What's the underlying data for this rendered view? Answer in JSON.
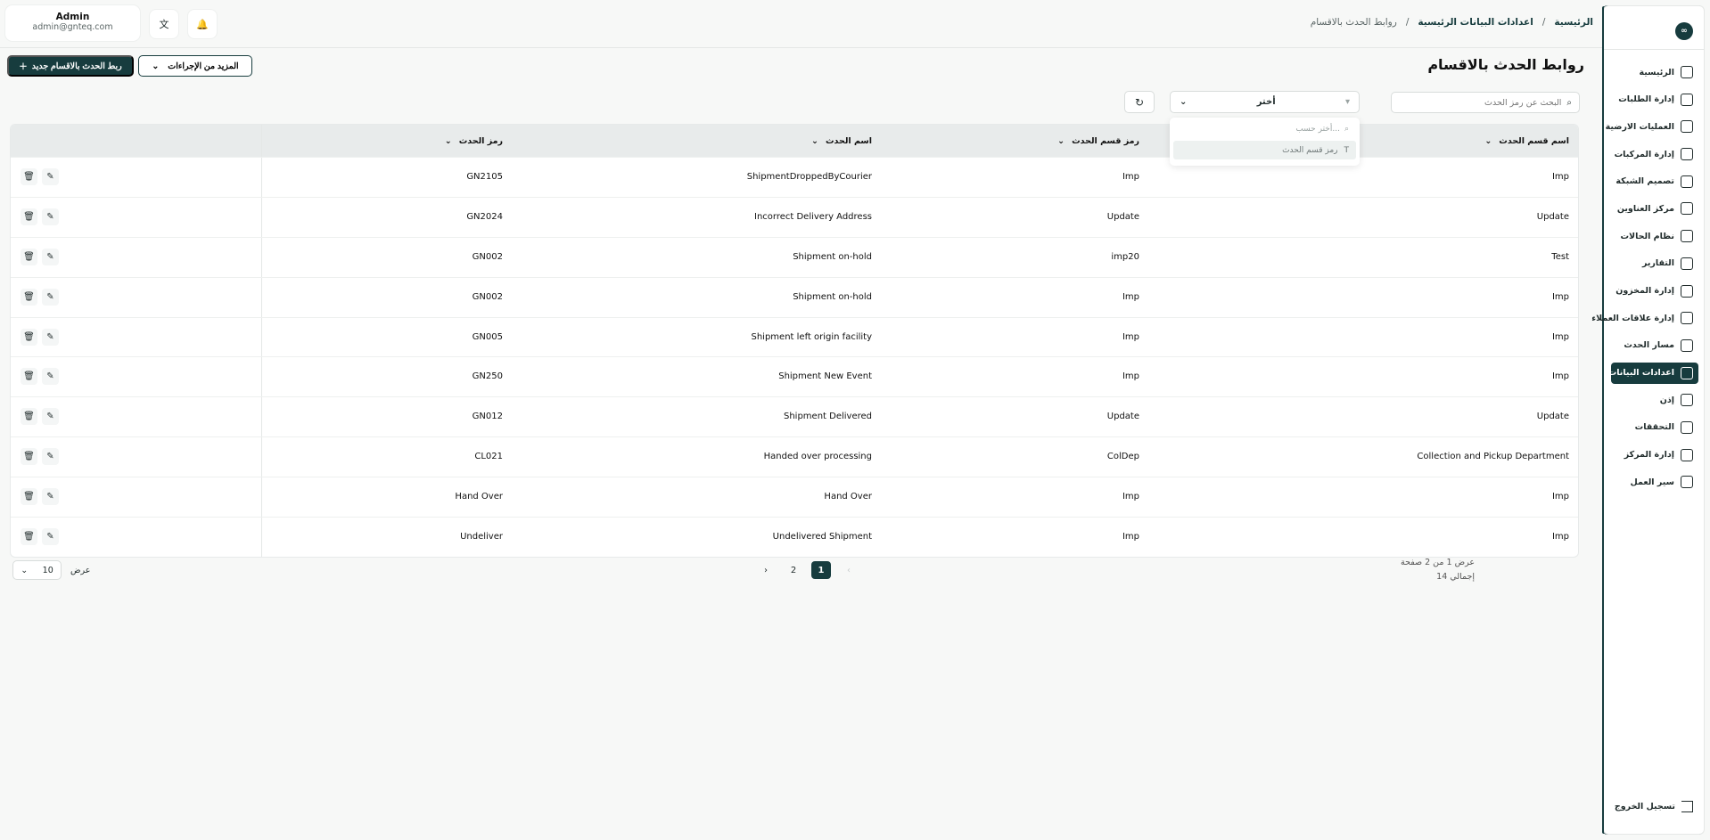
{
  "sidebar": {
    "logo": "∞",
    "items": [
      {
        "label": "الرئيسية",
        "icon": "dashboard-icon",
        "active": false
      },
      {
        "label": "إدارة الطلبات",
        "icon": "orders-icon",
        "active": false
      },
      {
        "label": "العمليات الارضية",
        "icon": "ground-ops-icon",
        "active": false
      },
      {
        "label": "إدارة المركبات",
        "icon": "truck-icon",
        "active": false
      },
      {
        "label": "تصميم الشبكة",
        "icon": "network-icon",
        "active": false
      },
      {
        "label": "مركز العناوين",
        "icon": "address-icon",
        "active": false
      },
      {
        "label": "نظام الحالات",
        "icon": "status-icon",
        "active": false
      },
      {
        "label": "التقارير",
        "icon": "reports-icon",
        "active": false
      },
      {
        "label": "إدارة المخزون",
        "icon": "inventory-icon",
        "active": false
      },
      {
        "label": "إدارة علاقات العملاء",
        "icon": "crm-icon",
        "active": false
      },
      {
        "label": "مسار الحدث",
        "icon": "route-icon",
        "active": false
      },
      {
        "label": "اعدادات البيانات",
        "icon": "database-icon",
        "active": true
      },
      {
        "label": "إذن",
        "icon": "permission-icon",
        "active": false
      },
      {
        "label": "التحققات",
        "icon": "validation-icon",
        "active": false
      },
      {
        "label": "إدارة المركز",
        "icon": "center-icon",
        "active": false
      },
      {
        "label": "سير العمل",
        "icon": "workflow-icon",
        "active": false
      }
    ],
    "logout": "تسجيل الخروج"
  },
  "header": {
    "breadcrumb": [
      "الرئيسية",
      "اعدادات البيانات الرئيسية",
      "روابط الحدث بالاقسام"
    ],
    "user": {
      "name": "Admin",
      "email": "admin@gnteq.com"
    },
    "translate_icon": "translate-icon",
    "bell_icon": "bell-icon"
  },
  "page": {
    "title": "روابط الحدث بالاقسام",
    "primary_button": "ربط الحدث بالاقسام جديد",
    "more_button": "المزيد من الإجراءات",
    "search_placeholder": "البحث عن رمز الحدث",
    "filter_label": "أختر",
    "dropdown_search_placeholder": "أختر حسب...",
    "dropdown_option": "رمز قسم الحدث"
  },
  "table": {
    "headers": {
      "department_name": "اسم قسم الحدث",
      "department_code": "رمز قسم الحدث",
      "event_name": "اسم الحدث",
      "event_code": "رمز الحدث"
    },
    "rows": [
      {
        "department_name": "Imp",
        "department_code": "Imp",
        "event_name": "ShipmentDroppedByCourier",
        "event_code": "GN2105"
      },
      {
        "department_name": "Update",
        "department_code": "Update",
        "event_name": "Incorrect Delivery Address",
        "event_code": "GN2024"
      },
      {
        "department_name": "Test",
        "department_code": "imp20",
        "event_name": "Shipment on-hold",
        "event_code": "GN002"
      },
      {
        "department_name": "Imp",
        "department_code": "Imp",
        "event_name": "Shipment on-hold",
        "event_code": "GN002"
      },
      {
        "department_name": "Imp",
        "department_code": "Imp",
        "event_name": "Shipment left origin facility",
        "event_code": "GN005"
      },
      {
        "department_name": "Imp",
        "department_code": "Imp",
        "event_name": "Shipment New Event",
        "event_code": "GN250"
      },
      {
        "department_name": "Update",
        "department_code": "Update",
        "event_name": "Shipment Delivered",
        "event_code": "GN012"
      },
      {
        "department_name": "Collection and Pickup Department",
        "department_code": "ColDep",
        "event_name": "Handed over processing",
        "event_code": "CL021"
      },
      {
        "department_name": "Imp",
        "department_code": "Imp",
        "event_name": "Hand Over",
        "event_code": "Hand Over"
      },
      {
        "department_name": "Imp",
        "department_code": "Imp",
        "event_name": "Undelivered Shipment",
        "event_code": "Undeliver"
      }
    ]
  },
  "pagination": {
    "show_label": "عرض",
    "page_size": "10",
    "pages": [
      "1",
      "2"
    ],
    "current_page": "1",
    "summary_line1": "عرض 1 من 2 صفحة",
    "summary_line2": "إجمالي 14"
  }
}
